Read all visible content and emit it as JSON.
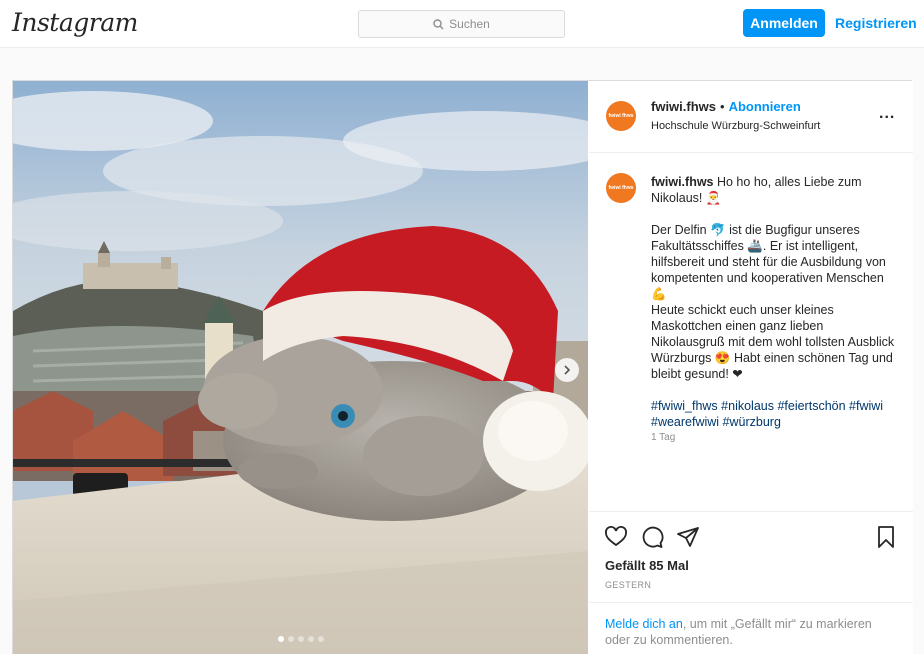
{
  "header": {
    "logo": "Instagram",
    "search_placeholder": "Suchen",
    "login_label": "Anmelden",
    "register_label": "Registrieren"
  },
  "post": {
    "username": "fwiwi.fhws",
    "follow_label": "Abonnieren",
    "location": "Hochschule Würzburg-Schweinfurt",
    "more_label": "...",
    "avatar_text": "fwiwi fhws",
    "caption": {
      "username": "fwiwi.fhws",
      "line1": "Ho ho ho, alles Liebe zum Nikolaus! 🎅",
      "line2": "Der Delfin 🐬 ist die Bugfigur unseres Fakultätsschiffes 🚢. Er ist intelligent, hilfsbereit und steht für die Ausbildung von kompetenten und kooperativen Menschen 💪",
      "line3": "Heute schickt euch unser kleines Maskottchen einen ganz lieben Nikolausgruß mit dem wohl tollsten Ausblick Würzburgs 😍 Habt einen schönen Tag und bleibt gesund! ❤",
      "hashtags": "#fwiwi_fhws #nikolaus #feiertschön #fwiwi #wearefwiwi #würzburg",
      "time_ago": "1 Tag"
    },
    "likes": "Gefällt 85 Mal",
    "date": "GESTERN",
    "login_prompt": {
      "link": "Melde dich an",
      "text": ", um mit „Gefällt mir“ zu markieren oder zu kommentieren."
    },
    "carousel": {
      "count": 5,
      "active_index": 0
    }
  },
  "colors": {
    "accent": "#0095f6",
    "avatar": "#f07820",
    "hashtag": "#00376b"
  }
}
